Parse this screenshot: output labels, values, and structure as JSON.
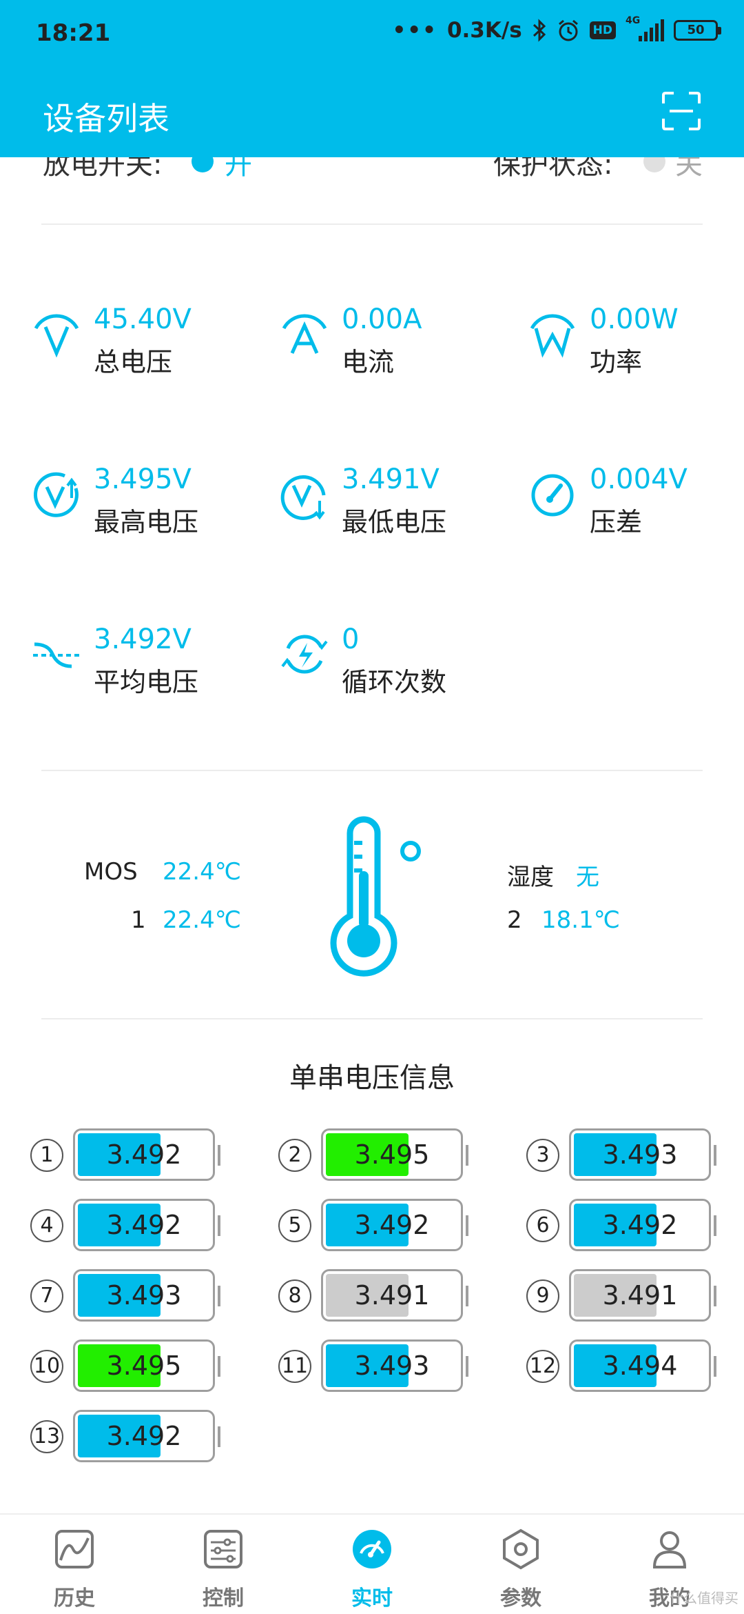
{
  "status": {
    "time": "18:21",
    "speed": "0.3K/s",
    "hd": "HD",
    "net": "4G",
    "battery": "50"
  },
  "header": {
    "title": "设备列表"
  },
  "switch_row": {
    "left_label": "放电开关:",
    "left_value": "开",
    "right_label": "保护状态:",
    "right_value": "关"
  },
  "metrics": [
    {
      "value": "45.40V",
      "label": "总电压",
      "icon": "voltage-icon"
    },
    {
      "value": "0.00A",
      "label": "电流",
      "icon": "current-icon"
    },
    {
      "value": "0.00W",
      "label": "功率",
      "icon": "power-icon"
    },
    {
      "value": "3.495V",
      "label": "最高电压",
      "icon": "max-voltage-icon"
    },
    {
      "value": "3.491V",
      "label": "最低电压",
      "icon": "min-voltage-icon"
    },
    {
      "value": "0.004V",
      "label": "压差",
      "icon": "gauge-icon"
    },
    {
      "value": "3.492V",
      "label": "平均电压",
      "icon": "avg-voltage-icon"
    },
    {
      "value": "0",
      "label": "循环次数",
      "icon": "cycle-icon"
    }
  ],
  "temperature": {
    "mos_label": "MOS",
    "mos_value": "22.4℃",
    "t1_label": "1",
    "t1_value": "22.4℃",
    "humidity_label": "湿度",
    "humidity_value": "无",
    "t2_label": "2",
    "t2_value": "18.1℃"
  },
  "cells": {
    "title": "单串电压信息",
    "items": [
      {
        "num": "1",
        "value": "3.492",
        "state": "normal"
      },
      {
        "num": "2",
        "value": "3.495",
        "state": "max"
      },
      {
        "num": "3",
        "value": "3.493",
        "state": "normal"
      },
      {
        "num": "4",
        "value": "3.492",
        "state": "normal"
      },
      {
        "num": "5",
        "value": "3.492",
        "state": "normal"
      },
      {
        "num": "6",
        "value": "3.492",
        "state": "normal"
      },
      {
        "num": "7",
        "value": "3.493",
        "state": "normal"
      },
      {
        "num": "8",
        "value": "3.491",
        "state": "min"
      },
      {
        "num": "9",
        "value": "3.491",
        "state": "min"
      },
      {
        "num": "10",
        "value": "3.495",
        "state": "max"
      },
      {
        "num": "11",
        "value": "3.493",
        "state": "normal"
      },
      {
        "num": "12",
        "value": "3.494",
        "state": "normal"
      },
      {
        "num": "13",
        "value": "3.492",
        "state": "normal"
      }
    ],
    "colors": {
      "normal": "#00BCEA",
      "max": "#22EE00",
      "min": "#CCCCCC"
    }
  },
  "nav": [
    {
      "label": "历史",
      "icon": "history-chart-icon",
      "active": false
    },
    {
      "label": "控制",
      "icon": "sliders-icon",
      "active": false
    },
    {
      "label": "实时",
      "icon": "dashboard-icon",
      "active": true
    },
    {
      "label": "参数",
      "icon": "hexagon-nut-icon",
      "active": false
    },
    {
      "label": "我的",
      "icon": "user-icon",
      "active": false
    }
  ],
  "watermark": "什么值得买",
  "colors": {
    "accent": "#00BCEA",
    "text": "#222222"
  }
}
